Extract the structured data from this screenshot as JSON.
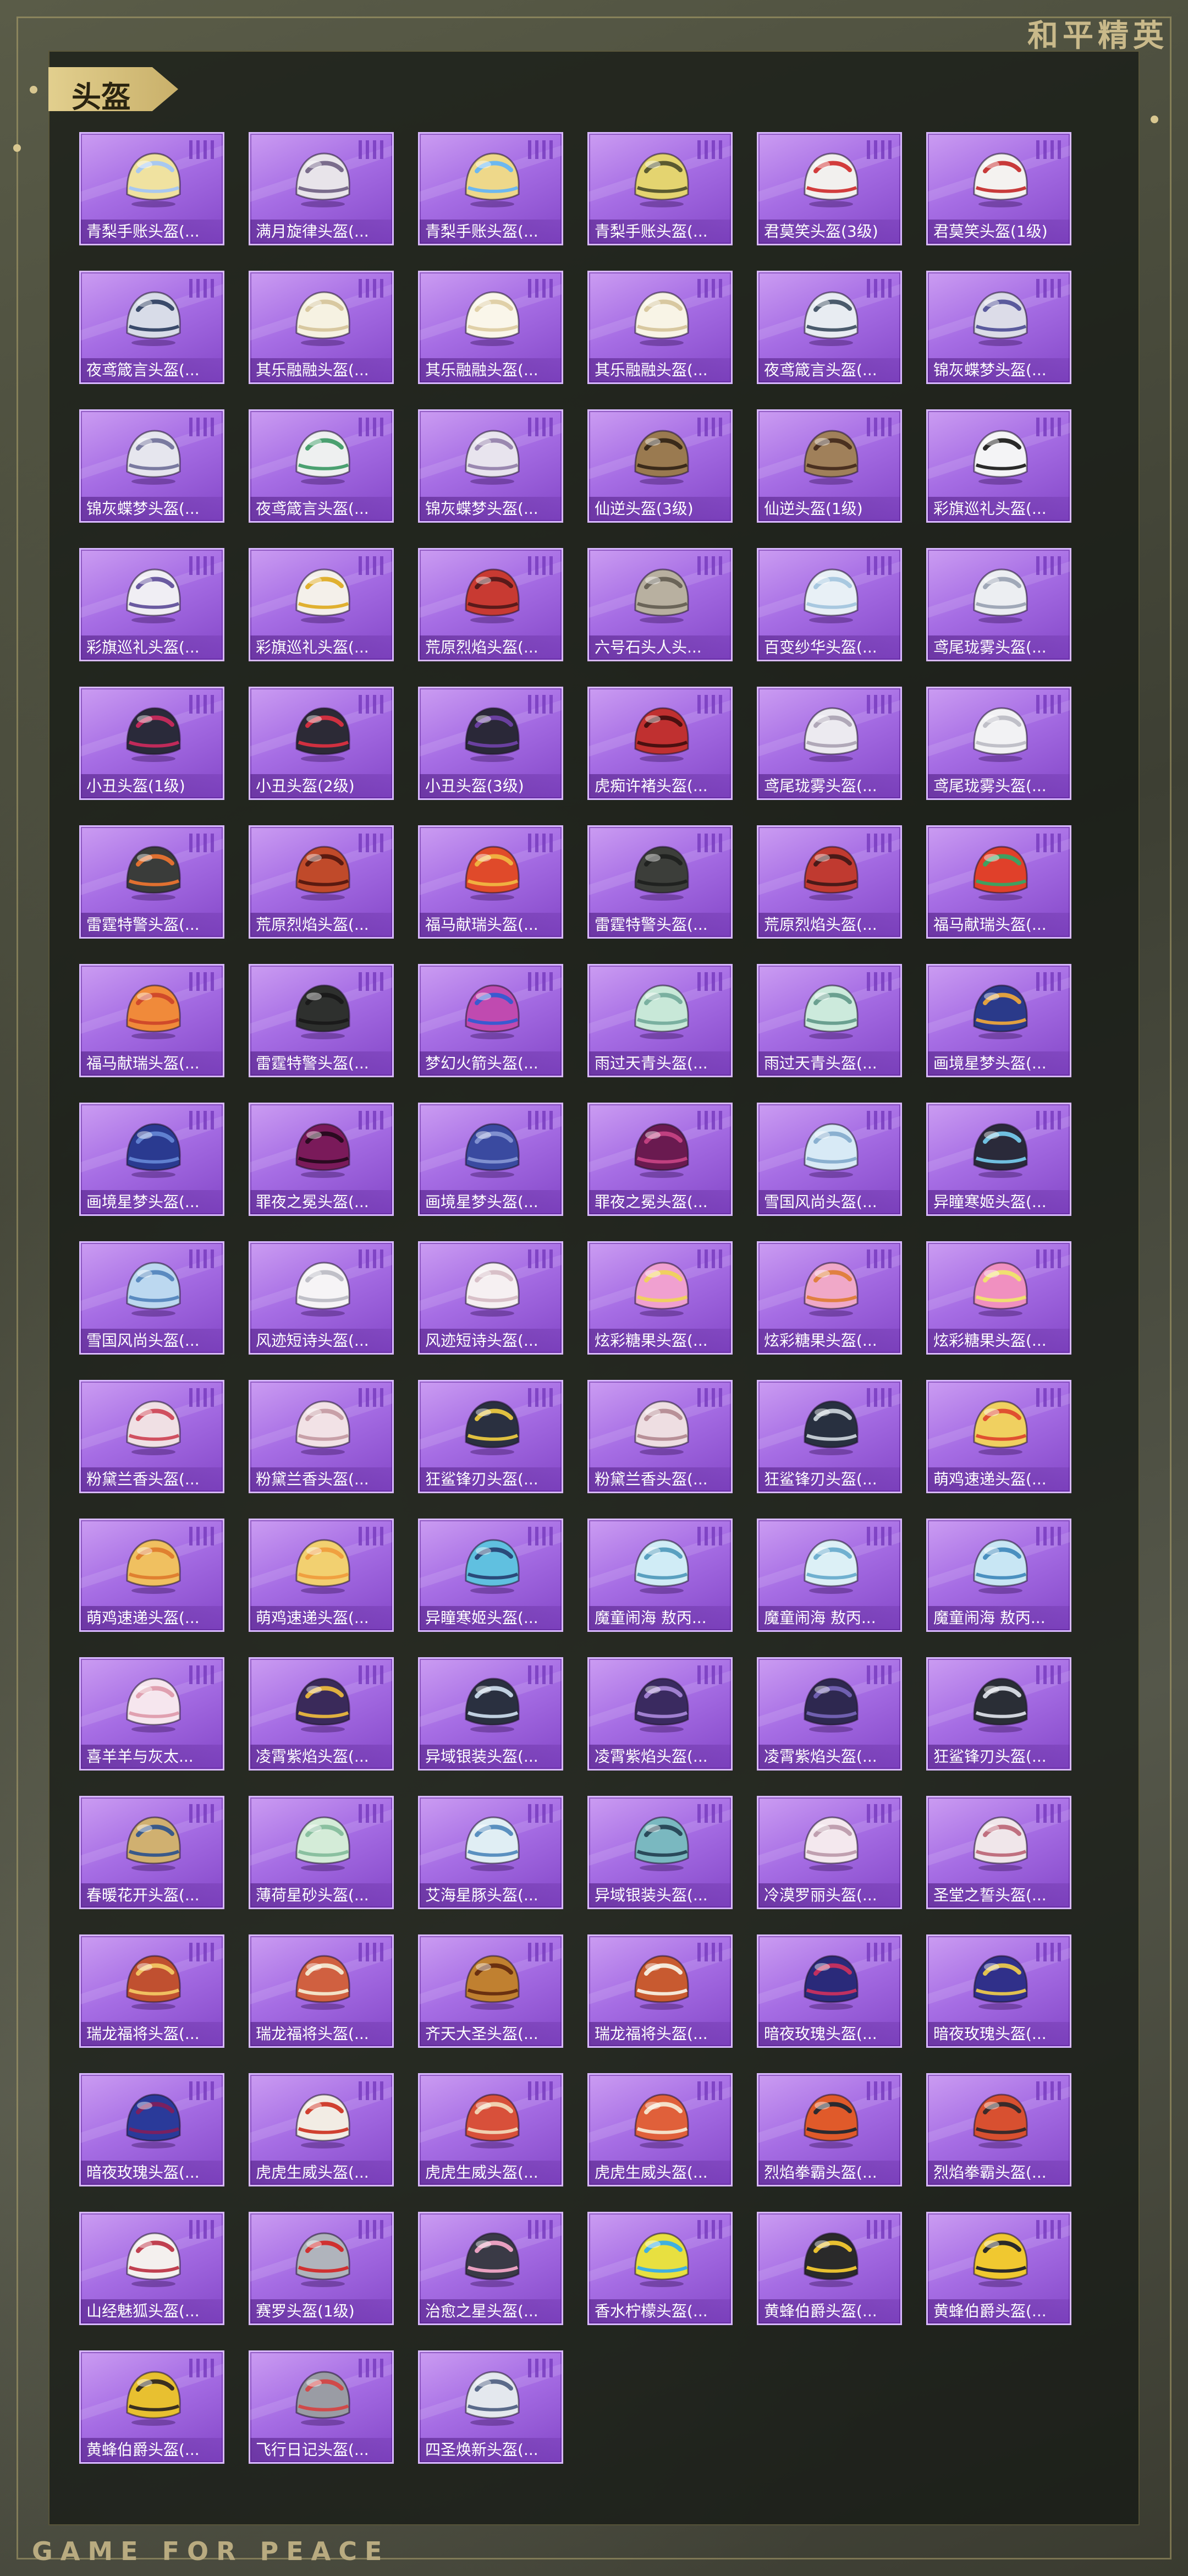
{
  "brand": "和平精英",
  "footer": "GAME FOR PEACE",
  "section": {
    "title": "头盔"
  },
  "colors": {
    "card_base": "#a66de4",
    "card_border": "#d8b8ff",
    "tag_gold": "#d8c07a",
    "frame": "#c9b98a"
  },
  "items": [
    {
      "name": "青梨手账头盔(...",
      "c1": "#f0e2a0",
      "c2": "#a8c8f0",
      "icon": "helmet-icon"
    },
    {
      "name": "满月旋律头盔(...",
      "c1": "#e8e4ea",
      "c2": "#7a6c8c",
      "icon": "helmet-icon"
    },
    {
      "name": "青梨手账头盔(...",
      "c1": "#eed88a",
      "c2": "#6cb8f0",
      "icon": "helmet-icon"
    },
    {
      "name": "青梨手账头盔(...",
      "c1": "#e4d470",
      "c2": "#5a5a30",
      "icon": "helmet-icon"
    },
    {
      "name": "君莫笑头盔(3级)",
      "c1": "#f2f0ee",
      "c2": "#d23c3c",
      "icon": "helmet-icon"
    },
    {
      "name": "君莫笑头盔(1级)",
      "c1": "#f4f2f0",
      "c2": "#c83a3a",
      "icon": "helmet-icon"
    },
    {
      "name": "夜鸢箴言头盔(...",
      "c1": "#d8dce8",
      "c2": "#3a4a6a",
      "icon": "helmet-icon"
    },
    {
      "name": "其乐融融头盔(...",
      "c1": "#f6f2e2",
      "c2": "#d8c8a0",
      "icon": "helmet-icon"
    },
    {
      "name": "其乐融融头盔(...",
      "c1": "#faf6ea",
      "c2": "#e0d0a8",
      "icon": "helmet-icon"
    },
    {
      "name": "其乐融融头盔(...",
      "c1": "#f8f4e6",
      "c2": "#d8c8a0",
      "icon": "helmet-icon"
    },
    {
      "name": "夜鸢箴言头盔(...",
      "c1": "#e8ecf2",
      "c2": "#4a5a6c",
      "icon": "helmet-icon"
    },
    {
      "name": "锦灰蝶梦头盔(...",
      "c1": "#dcdce8",
      "c2": "#5a5a9c",
      "icon": "helmet-icon"
    },
    {
      "name": "锦灰蝶梦头盔(...",
      "c1": "#e6e6ee",
      "c2": "#7a7aa0",
      "icon": "helmet-icon"
    },
    {
      "name": "夜鸢箴言头盔(...",
      "c1": "#eef0f0",
      "c2": "#4aa070",
      "icon": "helmet-icon"
    },
    {
      "name": "锦灰蝶梦头盔(...",
      "c1": "#e8e4ee",
      "c2": "#9a88b0",
      "icon": "helmet-icon"
    },
    {
      "name": "仙逆头盔(3级)",
      "c1": "#9a7a50",
      "c2": "#3a2a1a",
      "icon": "helmet-icon"
    },
    {
      "name": "仙逆头盔(1级)",
      "c1": "#a0805a",
      "c2": "#4a3020",
      "icon": "helmet-icon"
    },
    {
      "name": "彩旗巡礼头盔(...",
      "c1": "#f4f4f6",
      "c2": "#2a2a2a",
      "icon": "helmet-icon"
    },
    {
      "name": "彩旗巡礼头盔(...",
      "c1": "#f0eef4",
      "c2": "#6a5aa0",
      "icon": "helmet-icon"
    },
    {
      "name": "彩旗巡礼头盔(...",
      "c1": "#f4f0ea",
      "c2": "#e0b030",
      "icon": "helmet-icon"
    },
    {
      "name": "荒原烈焰头盔(...",
      "c1": "#c83a32",
      "c2": "#5a1a1a",
      "icon": "helmet-icon"
    },
    {
      "name": "六号石头人头...",
      "c1": "#b8b0a0",
      "c2": "#6a6458",
      "icon": "helmet-icon"
    },
    {
      "name": "百变纱华头盔(...",
      "c1": "#e8f0f6",
      "c2": "#a8c8e0",
      "icon": "helmet-icon"
    },
    {
      "name": "鸢尾珑雾头盔(...",
      "c1": "#eceef2",
      "c2": "#a0a8b8",
      "icon": "helmet-icon"
    },
    {
      "name": "小丑头盔(1级)",
      "c1": "#2a2a3a",
      "c2": "#c02a5a",
      "icon": "helmet-icon"
    },
    {
      "name": "小丑头盔(2级)",
      "c1": "#2c2a36",
      "c2": "#d03040",
      "icon": "helmet-icon"
    },
    {
      "name": "小丑头盔(3级)",
      "c1": "#2a2838",
      "c2": "#6a40a0",
      "icon": "helmet-icon"
    },
    {
      "name": "虎痴许褚头盔(...",
      "c1": "#c03030",
      "c2": "#4a1010",
      "icon": "helmet-icon"
    },
    {
      "name": "鸢尾珑雾头盔(...",
      "c1": "#eceaf0",
      "c2": "#b0a8b8",
      "icon": "helmet-icon"
    },
    {
      "name": "鸢尾珑雾头盔(...",
      "c1": "#f2f2f4",
      "c2": "#c0c0c8",
      "icon": "helmet-icon"
    },
    {
      "name": "雷霆特警头盔(...",
      "c1": "#3a3c3a",
      "c2": "#e07030",
      "icon": "helmet-icon"
    },
    {
      "name": "荒原烈焰头盔(...",
      "c1": "#c04a2a",
      "c2": "#5a1a10",
      "icon": "helmet-icon"
    },
    {
      "name": "福马献瑞头盔(...",
      "c1": "#e04a2a",
      "c2": "#f0b040",
      "icon": "helmet-icon"
    },
    {
      "name": "雷霆特警头盔(...",
      "c1": "#3c3e3a",
      "c2": "#202220",
      "icon": "helmet-icon"
    },
    {
      "name": "荒原烈焰头盔(...",
      "c1": "#c03a30",
      "c2": "#4a1a18",
      "icon": "helmet-icon"
    },
    {
      "name": "福马献瑞头盔(...",
      "c1": "#e0402a",
      "c2": "#40a060",
      "icon": "helmet-icon"
    },
    {
      "name": "福马献瑞头盔(...",
      "c1": "#f08a3a",
      "c2": "#d04a2a",
      "icon": "helmet-icon"
    },
    {
      "name": "雷霆特警头盔(...",
      "c1": "#2e302e",
      "c2": "#1a1a1a",
      "icon": "helmet-icon"
    },
    {
      "name": "梦幻火箭头盔(...",
      "c1": "#c04ab0",
      "c2": "#3a5ad0",
      "icon": "helmet-icon"
    },
    {
      "name": "雨过天青头盔(...",
      "c1": "#c8e8d8",
      "c2": "#7ab0a0",
      "icon": "helmet-icon"
    },
    {
      "name": "雨过天青头盔(...",
      "c1": "#cceadc",
      "c2": "#6aa090",
      "icon": "helmet-icon"
    },
    {
      "name": "画境星梦头盔(...",
      "c1": "#2a3a8a",
      "c2": "#e0a040",
      "icon": "helmet-icon"
    },
    {
      "name": "画境星梦头盔(...",
      "c1": "#2a3a90",
      "c2": "#6080d0",
      "icon": "helmet-icon"
    },
    {
      "name": "罪夜之冕头盔(...",
      "c1": "#7a1a5a",
      "c2": "#2a0a20",
      "icon": "helmet-icon"
    },
    {
      "name": "画境星梦头盔(...",
      "c1": "#3a4aa0",
      "c2": "#8090d0",
      "icon": "helmet-icon"
    },
    {
      "name": "罪夜之冕头盔(...",
      "c1": "#6a1a50",
      "c2": "#c04080",
      "icon": "helmet-icon"
    },
    {
      "name": "雪国风尚头盔(...",
      "c1": "#d8eaf6",
      "c2": "#8ab0d0",
      "icon": "helmet-icon"
    },
    {
      "name": "异瞳寒姬头盔(...",
      "c1": "#2a2a3a",
      "c2": "#70c0e0",
      "icon": "helmet-icon"
    },
    {
      "name": "雪国风尚头盔(...",
      "c1": "#bcd8f0",
      "c2": "#5a8ac0",
      "icon": "helmet-icon"
    },
    {
      "name": "风迹短诗头盔(...",
      "c1": "#f6f4f6",
      "c2": "#c0c0c8",
      "icon": "helmet-icon"
    },
    {
      "name": "风迹短诗头盔(...",
      "c1": "#f6f0f2",
      "c2": "#d8c0c8",
      "icon": "helmet-icon"
    },
    {
      "name": "炫彩糖果头盔(...",
      "c1": "#f0a0d0",
      "c2": "#f0d060",
      "icon": "helmet-icon"
    },
    {
      "name": "炫彩糖果头盔(...",
      "c1": "#f0a8c8",
      "c2": "#e08040",
      "icon": "helmet-icon"
    },
    {
      "name": "炫彩糖果头盔(...",
      "c1": "#f090c0",
      "c2": "#f0e070",
      "icon": "helmet-icon"
    },
    {
      "name": "粉黛兰香头盔(...",
      "c1": "#f0e0e4",
      "c2": "#d05060",
      "icon": "helmet-icon"
    },
    {
      "name": "粉黛兰香头盔(...",
      "c1": "#f2e2e6",
      "c2": "#c8a0a8",
      "icon": "helmet-icon"
    },
    {
      "name": "狂鲨锋刃头盔(...",
      "c1": "#2a3040",
      "c2": "#e0c040",
      "icon": "helmet-icon"
    },
    {
      "name": "粉黛兰香头盔(...",
      "c1": "#eedee2",
      "c2": "#b89098",
      "icon": "helmet-icon"
    },
    {
      "name": "狂鲨锋刃头盔(...",
      "c1": "#283040",
      "c2": "#c0c8d0",
      "icon": "helmet-icon"
    },
    {
      "name": "萌鸡速递头盔(...",
      "c1": "#f0d060",
      "c2": "#e05030",
      "icon": "helmet-icon"
    },
    {
      "name": "萌鸡速递头盔(...",
      "c1": "#f0c060",
      "c2": "#e08030",
      "icon": "helmet-icon"
    },
    {
      "name": "萌鸡速递头盔(...",
      "c1": "#f2d070",
      "c2": "#f0a040",
      "icon": "helmet-icon"
    },
    {
      "name": "异瞳寒姬头盔(...",
      "c1": "#60c0e0",
      "c2": "#2a4a7a",
      "icon": "helmet-icon"
    },
    {
      "name": "魔童闹海 敖丙...",
      "c1": "#d0ecf6",
      "c2": "#5aa0c0",
      "icon": "helmet-icon"
    },
    {
      "name": "魔童闹海 敖丙...",
      "c1": "#dcf0f6",
      "c2": "#70b0d0",
      "icon": "helmet-icon"
    },
    {
      "name": "魔童闹海 敖丙...",
      "c1": "#c8e6f4",
      "c2": "#4a90c0",
      "icon": "helmet-icon"
    },
    {
      "name": "喜羊羊与灰太...",
      "c1": "#f6e6ee",
      "c2": "#e0a0b0",
      "icon": "helmet-icon"
    },
    {
      "name": "凌霄紫焰头盔(...",
      "c1": "#3a2a5a",
      "c2": "#e0b040",
      "icon": "helmet-icon"
    },
    {
      "name": "异域银装头盔(...",
      "c1": "#2a3040",
      "c2": "#c0d0e0",
      "icon": "helmet-icon"
    },
    {
      "name": "凌霄紫焰头盔(...",
      "c1": "#3a2a60",
      "c2": "#a080d0",
      "icon": "helmet-icon"
    },
    {
      "name": "凌霄紫焰头盔(...",
      "c1": "#2e2850",
      "c2": "#7060b0",
      "icon": "helmet-icon"
    },
    {
      "name": "狂鲨锋刃头盔(...",
      "c1": "#2a2e36",
      "c2": "#d0d4dc",
      "icon": "helmet-icon"
    },
    {
      "name": "春暖花开头盔(...",
      "c1": "#d0b070",
      "c2": "#3a5a8a",
      "icon": "helmet-icon"
    },
    {
      "name": "薄荷星砂头盔(...",
      "c1": "#d4ecd8",
      "c2": "#8ac0a0",
      "icon": "helmet-icon"
    },
    {
      "name": "艾海星豚头盔(...",
      "c1": "#e0eef4",
      "c2": "#5a90c0",
      "icon": "helmet-icon"
    },
    {
      "name": "异域银装头盔(...",
      "c1": "#7ab8c0",
      "c2": "#2a4a5a",
      "icon": "helmet-icon"
    },
    {
      "name": "冷漠罗丽头盔(...",
      "c1": "#f4e8ee",
      "c2": "#c0a0b0",
      "icon": "helmet-icon"
    },
    {
      "name": "圣堂之誓头盔(...",
      "c1": "#f0e6ea",
      "c2": "#c07080",
      "icon": "helmet-icon"
    },
    {
      "name": "瑞龙福将头盔(...",
      "c1": "#c05030",
      "c2": "#f0c060",
      "icon": "helmet-icon"
    },
    {
      "name": "瑞龙福将头盔(...",
      "c1": "#d06040",
      "c2": "#f2e2c8",
      "icon": "helmet-icon"
    },
    {
      "name": "齐天大圣头盔(...",
      "c1": "#c08030",
      "c2": "#6a3010",
      "icon": "helmet-icon"
    },
    {
      "name": "瑞龙福将头盔(...",
      "c1": "#c85a30",
      "c2": "#f4e8d8",
      "icon": "helmet-icon"
    },
    {
      "name": "暗夜玫瑰头盔(...",
      "c1": "#2a2a7a",
      "c2": "#c03060",
      "icon": "helmet-icon"
    },
    {
      "name": "暗夜玫瑰头盔(...",
      "c1": "#30308a",
      "c2": "#e0c050",
      "icon": "helmet-icon"
    },
    {
      "name": "暗夜玫瑰头盔(...",
      "c1": "#2a3a9a",
      "c2": "#7a2060",
      "icon": "helmet-icon"
    },
    {
      "name": "虎虎生威头盔(...",
      "c1": "#f2ece4",
      "c2": "#d04030",
      "icon": "helmet-icon"
    },
    {
      "name": "虎虎生威头盔(...",
      "c1": "#d8503a",
      "c2": "#f0d0b0",
      "icon": "helmet-icon"
    },
    {
      "name": "虎虎生威头盔(...",
      "c1": "#e0603a",
      "c2": "#f4e0c8",
      "icon": "helmet-icon"
    },
    {
      "name": "烈焰拳霸头盔(...",
      "c1": "#e05a2a",
      "c2": "#2a2a30",
      "icon": "helmet-icon"
    },
    {
      "name": "烈焰拳霸头盔(...",
      "c1": "#d85030",
      "c2": "#3a2a2a",
      "icon": "helmet-icon"
    },
    {
      "name": "山经魅狐头盔(...",
      "c1": "#f4f0ee",
      "c2": "#c04050",
      "icon": "helmet-icon"
    },
    {
      "name": "赛罗头盔(1级)",
      "c1": "#b0b4bc",
      "c2": "#d03030",
      "icon": "helmet-icon"
    },
    {
      "name": "治愈之星头盔(...",
      "c1": "#3a3a46",
      "c2": "#e8a0c0",
      "icon": "helmet-icon"
    },
    {
      "name": "香水柠檬头盔(...",
      "c1": "#e8e040",
      "c2": "#40b0e0",
      "icon": "helmet-icon"
    },
    {
      "name": "黄蜂伯爵头盔(...",
      "c1": "#2a2a2a",
      "c2": "#e8c030",
      "icon": "helmet-icon"
    },
    {
      "name": "黄蜂伯爵头盔(...",
      "c1": "#f0c830",
      "c2": "#2a2a2a",
      "icon": "helmet-icon"
    },
    {
      "name": "黄蜂伯爵头盔(...",
      "c1": "#e8c030",
      "c2": "#3a3020",
      "icon": "helmet-icon"
    },
    {
      "name": "飞行日记头盔(...",
      "c1": "#9a9ca4",
      "c2": "#d04a4a",
      "icon": "helmet-icon"
    },
    {
      "name": "四圣焕新头盔(...",
      "c1": "#e4e8ee",
      "c2": "#5a6a8a",
      "icon": "helmet-icon"
    }
  ]
}
